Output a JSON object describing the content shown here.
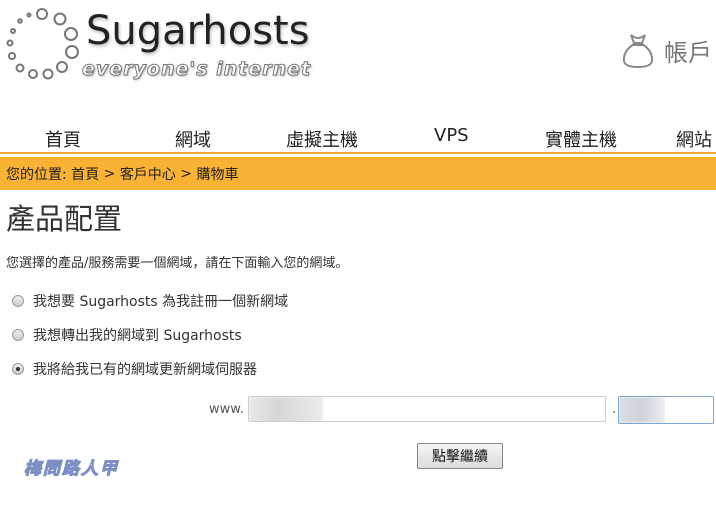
{
  "logo": {
    "title": "Sugarhosts",
    "tagline": "everyone's internet"
  },
  "account": {
    "label": "帳戶",
    "icon": "money-bag-icon"
  },
  "nav": {
    "items": [
      "首頁",
      "網域",
      "虛擬主機",
      "VPS",
      "實體主機",
      "網站"
    ]
  },
  "breadcrumb": {
    "prefix": "您的位置: ",
    "home": "首頁",
    "sep1": " > ",
    "client": "客戶中心",
    "sep2": " > ",
    "cart": "購物車"
  },
  "page": {
    "title": "產品配置",
    "description": "您選擇的產品/服務需要一個網域，請在下面輸入您的網域。"
  },
  "options": [
    {
      "label": "我想要 Sugarhosts 為我註冊一個新網域",
      "checked": false
    },
    {
      "label": "我想轉出我的網域到 Sugarhosts",
      "checked": false
    },
    {
      "label": "我將給我已有的網域更新網域伺服器",
      "checked": true
    }
  ],
  "domain_form": {
    "prefix": "www.",
    "separator": ".",
    "button": "點擊繼續"
  },
  "watermark": "梅問路人甲",
  "colors": {
    "accent": "#f9b233",
    "accent_line": "#f7a833"
  }
}
